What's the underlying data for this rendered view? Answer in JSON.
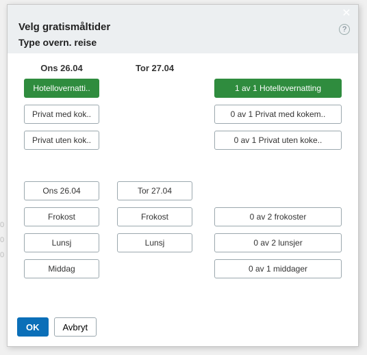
{
  "dialog": {
    "title": "Velg gratismåltider",
    "subtitle": "Type overn. reise"
  },
  "columns": {
    "day1": "Ons 26.04",
    "day2": "Tor 27.04"
  },
  "accom": {
    "hotel": {
      "day1": "Hotellovernatti..",
      "summary": "1 av 1 Hotellovernatting",
      "selected": true
    },
    "privKok": {
      "day1": "Privat med kok..",
      "summary": "0 av 1 Privat med kokem.."
    },
    "privUten": {
      "day1": "Privat uten kok..",
      "summary": "0 av 1 Privat uten koke.."
    }
  },
  "meals": {
    "dateRow": {
      "day1": "Ons 26.04",
      "day2": "Tor 27.04"
    },
    "frokost": {
      "day1": "Frokost",
      "day2": "Frokost",
      "summary": "0 av 2 frokoster"
    },
    "lunsj": {
      "day1": "Lunsj",
      "day2": "Lunsj",
      "summary": "0 av 2 lunsjer"
    },
    "middag": {
      "day1": "Middag",
      "summary": "0 av 1 middager"
    }
  },
  "footer": {
    "ok": "OK",
    "cancel": "Avbryt"
  },
  "bg": {
    "m1": "0",
    "m2": "0",
    "m3": "0"
  }
}
